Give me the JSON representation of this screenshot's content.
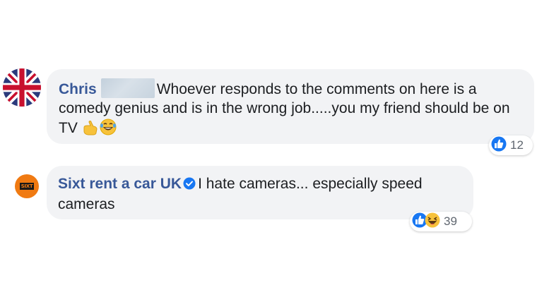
{
  "comments": [
    {
      "author": "Chris",
      "text": "Whoever responds to the comments on here is a comedy genius and is in the wrong job.....you my friend should be on TV",
      "emojis": [
        "thumbs-up-pointing-hand-emoji",
        "laughing-tears-emoji"
      ],
      "reactions": {
        "icons": [
          "like-icon"
        ],
        "count": "12"
      },
      "avatar": "union-jack-flag"
    },
    {
      "author": "Sixt rent a car UK",
      "verified": true,
      "text": "I hate cameras... especially speed cameras",
      "reactions": {
        "icons": [
          "like-icon",
          "haha-icon"
        ],
        "count": "39"
      },
      "avatar": "sixt-logo",
      "avatar_logo_text": "SIXT"
    }
  ],
  "colors": {
    "author": "#385898",
    "bubble": "#f2f3f5",
    "like_blue": "#1877f2",
    "sixt_orange": "#f07a12"
  }
}
